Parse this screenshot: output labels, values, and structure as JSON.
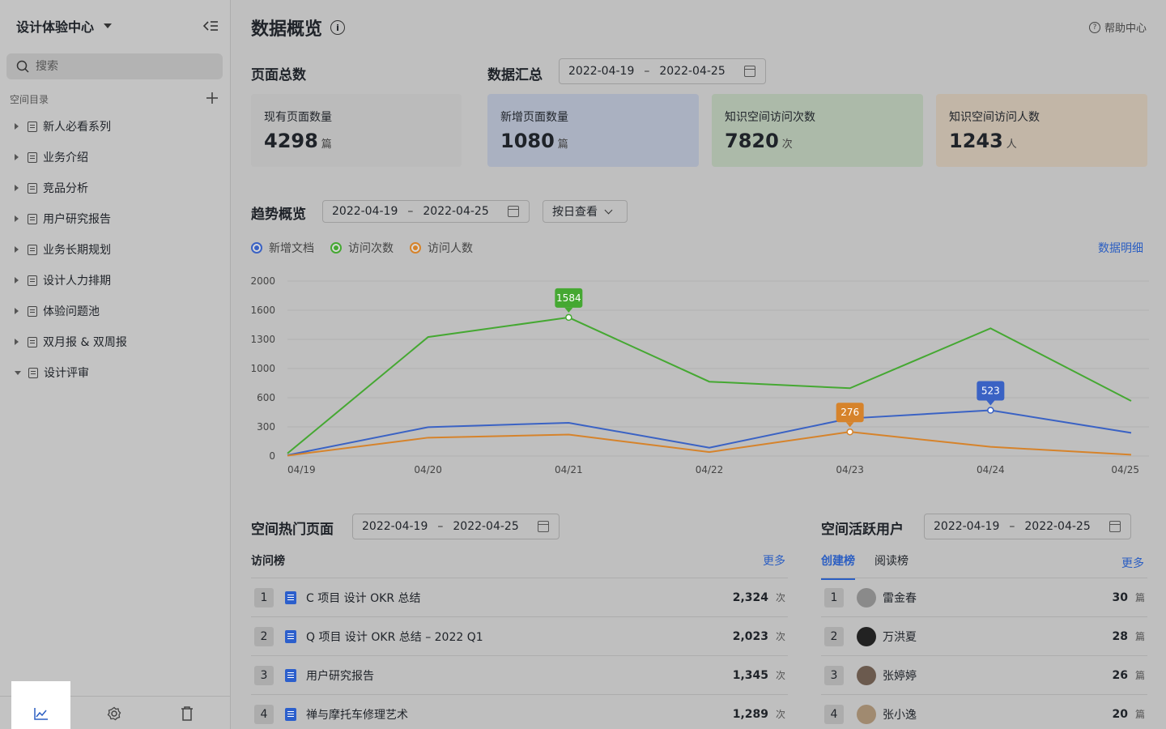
{
  "sidebar": {
    "space_name": "设计体验中心",
    "search_placeholder": "搜索",
    "dir_label": "空间目录",
    "items": [
      {
        "label": "新人必看系列"
      },
      {
        "label": "业务介绍"
      },
      {
        "label": "竞品分析"
      },
      {
        "label": "用户研究报告"
      },
      {
        "label": "业务长期规划"
      },
      {
        "label": "设计人力排期"
      },
      {
        "label": "体验问题池"
      },
      {
        "label": "双月报 & 双周报"
      },
      {
        "label": "设计评审"
      }
    ],
    "footer_icons": [
      "chart-icon",
      "gear-icon",
      "trash-icon"
    ]
  },
  "header": {
    "title": "数据概览",
    "help": "帮助中心"
  },
  "overview": {
    "total_title": "页面总数",
    "summary_title": "数据汇总",
    "date_start": "2022-04-19",
    "date_sep": "–",
    "date_end": "2022-04-25",
    "cards": [
      {
        "label": "现有页面数量",
        "value": "4298",
        "unit": "篇",
        "bg": "#bbbbbb"
      },
      {
        "label": "新增页面数量",
        "value": "1080",
        "unit": "篇",
        "bg": "#aab1c1"
      },
      {
        "label": "知识空间访问次数",
        "value": "7820",
        "unit": "次",
        "bg": "#acbaa9"
      },
      {
        "label": "知识空间访问人数",
        "value": "1243",
        "unit": "人",
        "bg": "#c2b6a7"
      }
    ]
  },
  "trend": {
    "title": "趋势概览",
    "date_start": "2022-04-19",
    "date_sep": "–",
    "date_end": "2022-04-25",
    "view_select": "按日查看",
    "detail_link": "数据明细",
    "legend": [
      {
        "name": "新增文档",
        "color": "#3a62c4"
      },
      {
        "name": "访问次数",
        "color": "#45a832"
      },
      {
        "name": "访问人数",
        "color": "#d6832b"
      }
    ]
  },
  "chart_data": {
    "type": "line",
    "x": [
      "04/19",
      "04/20",
      "04/21",
      "04/22",
      "04/23",
      "04/24",
      "04/25"
    ],
    "ylim": [
      0,
      2000
    ],
    "yticks": [
      "2000",
      "1600",
      "1300",
      "1000",
      "600",
      "300",
      "0"
    ],
    "series": [
      {
        "name": "新增文档",
        "values": [
          10,
          330,
          380,
          95,
          430,
          523,
          265
        ]
      },
      {
        "name": "访问次数",
        "values": [
          30,
          1360,
          1584,
          850,
          775,
          1460,
          630
        ]
      },
      {
        "name": "访问人数",
        "values": [
          5,
          210,
          245,
          45,
          276,
          105,
          15
        ]
      }
    ],
    "annotations": [
      {
        "series": "访问次数",
        "x": "04/21",
        "label": "1584"
      },
      {
        "series": "访问人数",
        "x": "04/23",
        "label": "276"
      },
      {
        "series": "新增文档",
        "x": "04/24",
        "label": "523"
      }
    ],
    "grid": true
  },
  "hot_pages": {
    "title": "空间热门页面",
    "date_start": "2022-04-19",
    "date_sep": "–",
    "date_end": "2022-04-25",
    "tab": "访问榜",
    "more": "更多",
    "rows": [
      {
        "rank": "1",
        "title": "C 项目 设计 OKR 总结",
        "count": "2,324",
        "unit": "次"
      },
      {
        "rank": "2",
        "title": "Q 项目 设计 OKR 总结 – 2022 Q1",
        "count": "2,023",
        "unit": "次"
      },
      {
        "rank": "3",
        "title": "用户研究报告",
        "count": "1,345",
        "unit": "次"
      },
      {
        "rank": "4",
        "title": "禅与摩托车修理艺术",
        "count": "1,289",
        "unit": "次"
      }
    ]
  },
  "active_users": {
    "title": "空间活跃用户",
    "date_start": "2022-04-19",
    "date_sep": "–",
    "date_end": "2022-04-25",
    "tab_active": "创建榜",
    "tab_other": "阅读榜",
    "more": "更多",
    "rows": [
      {
        "rank": "1",
        "name": "雷金春",
        "count": "30",
        "unit": "篇",
        "avatar_color": "#8a8a8a"
      },
      {
        "rank": "2",
        "name": "万洪夏",
        "count": "28",
        "unit": "篇",
        "avatar_color": "#222222"
      },
      {
        "rank": "3",
        "name": "张婷婷",
        "count": "26",
        "unit": "篇",
        "avatar_color": "#6b5a4e"
      },
      {
        "rank": "4",
        "name": "张小逸",
        "count": "20",
        "unit": "篇",
        "avatar_color": "#a08a70"
      }
    ]
  }
}
